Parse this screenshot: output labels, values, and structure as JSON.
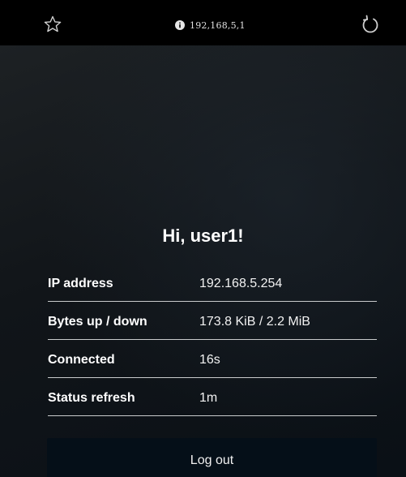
{
  "browser": {
    "url": "192,168,5,1",
    "icons": {
      "bookmark": "star-icon",
      "site_info": "info-icon",
      "reload": "reload-icon"
    }
  },
  "portal": {
    "greeting": "Hi, user1!",
    "rows": [
      {
        "label": "IP address",
        "value": "192.168.5.254"
      },
      {
        "label": "Bytes up / down",
        "value": "173.8 KiB / 2.2 MiB"
      },
      {
        "label": "Connected",
        "value": "16s"
      },
      {
        "label": "Status refresh",
        "value": "1m"
      }
    ],
    "logout_label": "Log out"
  },
  "colors": {
    "browser_bar": "#000000",
    "background_dark": "#0a1016",
    "button_bg": "#050f18",
    "divider": "#c9cbcc",
    "text": "#ffffff"
  }
}
